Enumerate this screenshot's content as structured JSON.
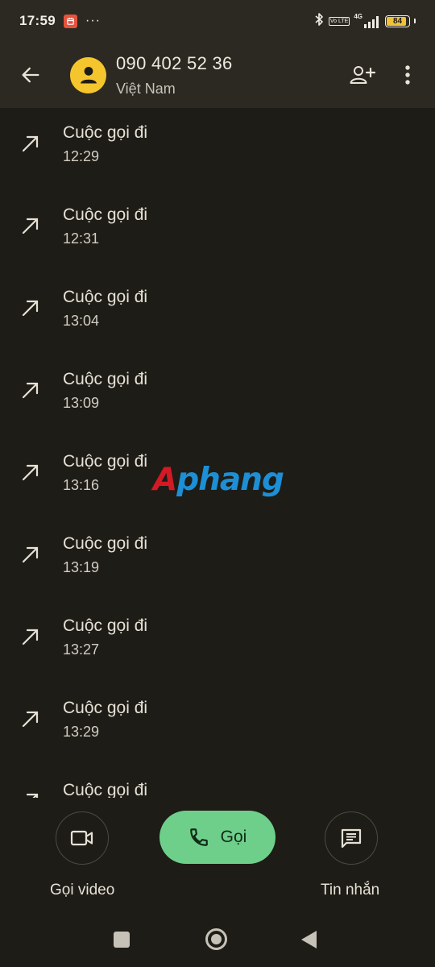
{
  "status_bar": {
    "time": "17:59",
    "notification_icon": "calendar-app-icon",
    "overflow": "···",
    "volte_label": "Vo LTE",
    "network_label": "4G",
    "battery_level": "84",
    "icons": [
      "bluetooth-icon",
      "signal-icon",
      "battery-icon"
    ]
  },
  "header": {
    "back_icon": "arrow-back-icon",
    "contact_number": "090 402 52 36",
    "contact_country": "Việt Nam",
    "add_contact_icon": "add-person-icon",
    "more_icon": "more-vert-icon"
  },
  "calls": [
    {
      "type": "Cuộc gọi đi",
      "time": "12:29"
    },
    {
      "type": "Cuộc gọi đi",
      "time": "12:31"
    },
    {
      "type": "Cuộc gọi đi",
      "time": "13:04"
    },
    {
      "type": "Cuộc gọi đi",
      "time": "13:09"
    },
    {
      "type": "Cuộc gọi đi",
      "time": "13:16"
    },
    {
      "type": "Cuộc gọi đi",
      "time": "13:19"
    },
    {
      "type": "Cuộc gọi đi",
      "time": "13:27"
    },
    {
      "type": "Cuộc gọi đi",
      "time": "13:29"
    },
    {
      "type": "Cuộc gọi đi",
      "time": ""
    }
  ],
  "watermark": {
    "first": "A",
    "rest": "phang"
  },
  "actions": {
    "video_label": "Gọi video",
    "call_label": "Gọi",
    "message_label": "Tin nhắn"
  },
  "colors": {
    "background": "#1e1c16",
    "header": "#2b2921",
    "avatar": "#f4c52d",
    "call_button": "#6ecf8b"
  }
}
